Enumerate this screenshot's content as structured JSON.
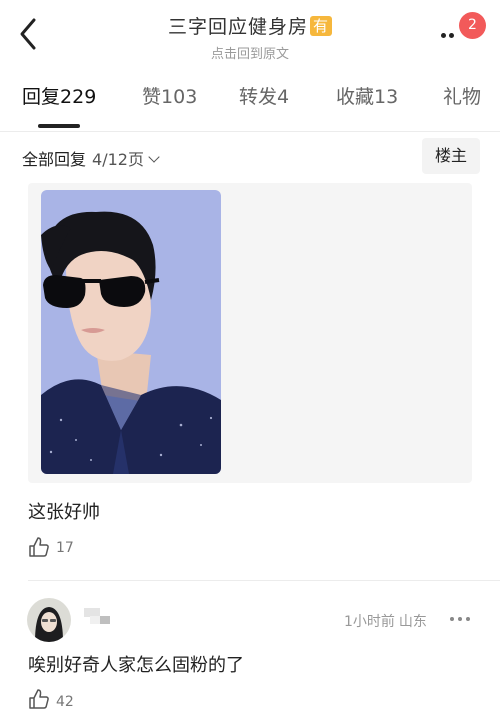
{
  "header": {
    "title": "三字回应健身房",
    "title_badge": "有",
    "subtitle": "点击回到原文",
    "notification_count": "2"
  },
  "tabs": [
    {
      "label": "回复",
      "count": "229",
      "active": true
    },
    {
      "label": "赞",
      "count": "103",
      "active": false
    },
    {
      "label": "转发",
      "count": "4",
      "active": false
    },
    {
      "label": "收藏",
      "count": "13",
      "active": false
    },
    {
      "label": "礼物",
      "count": "",
      "active": false
    }
  ],
  "filter": {
    "label": "全部回复",
    "page": "4/12页",
    "owner_button": "楼主"
  },
  "post": {
    "image_alt_icon": "portrait-photo",
    "text": "这张好帅",
    "likes": "17"
  },
  "comment": {
    "time": "1小时前",
    "location": "山东",
    "text": "唉别好奇人家怎么固粉的了",
    "likes": "42"
  },
  "colors": {
    "badge_red": "#f25a5a",
    "title_badge_orange": "#f6b73c",
    "photo_background": "#a9b4e6"
  }
}
